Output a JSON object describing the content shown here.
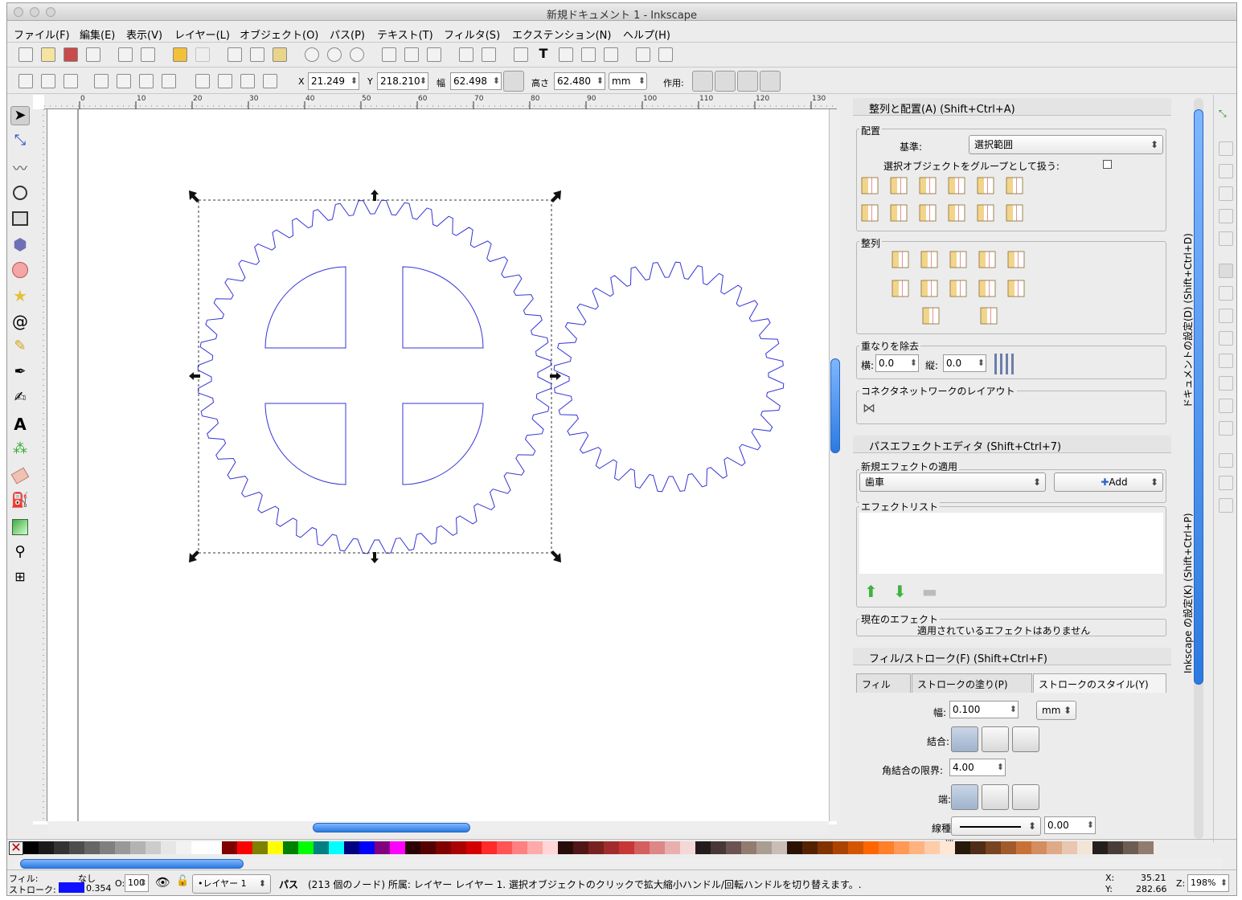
{
  "window": {
    "title": "新規ドキュメント 1 - Inkscape"
  },
  "menu": [
    "ファイル(F)",
    "編集(E)",
    "表示(V)",
    "レイヤー(L)",
    "オブジェクト(O)",
    "パス(P)",
    "テキスト(T)",
    "フィルタ(S)",
    "エクステンション(N)",
    "ヘルプ(H)"
  ],
  "controls": {
    "x_label": "X",
    "x_value": "21.249",
    "y_label": "Y",
    "y_value": "218.210",
    "w_label": "幅",
    "w_value": "62.498",
    "h_label": "高さ",
    "h_value": "62.480",
    "unit": "mm",
    "apply_label": "作用:"
  },
  "ruler": {
    "top": [
      "0",
      "10",
      "20",
      "30",
      "40",
      "50",
      "60",
      "70",
      "80",
      "90",
      "100",
      "110",
      "120",
      "130"
    ]
  },
  "align_panel": {
    "title": "整列と配置(A) (Shift+Ctrl+A)",
    "placement_label": "配置",
    "relative_label": "基準:",
    "relative_value": "選択範囲",
    "group_label": "選択オブジェクトをグループとして扱う:",
    "distribute_label": "整列",
    "overlap_label": "重なりを除去",
    "h_label": "横:",
    "h_value": "0.0",
    "v_label": "縦:",
    "v_value": "0.0",
    "connector_label": "コネクタネットワークのレイアウト"
  },
  "lpe_panel": {
    "title": "パスエフェクトエディタ (Shift+Ctrl+7)",
    "new_label": "新規エフェクトの適用",
    "effect_value": "歯車",
    "add_label": "Add",
    "list_label": "エフェクトリスト",
    "current_label": "現在のエフェクト",
    "current_value": "適用されているエフェクトはありません"
  },
  "fill_panel": {
    "title": "フィル/ストローク(F) (Shift+Ctrl+F)",
    "tab_fill": "フィル",
    "tab_stroke_paint": "ストロークの塗り(P)",
    "tab_stroke_style": "ストロークのスタイル(Y)",
    "width_label": "幅:",
    "width_value": "0.100",
    "width_unit": "mm",
    "join_label": "結合:",
    "miter_label": "角結合の限界:",
    "miter_value": "4.00",
    "cap_label": "端:",
    "dash_label": "線種:",
    "dash_offset": "0.00",
    "marker_label": "端"
  },
  "vertical_tabs": {
    "docprops": "ドキュメントの設定(D) (Shift+Ctrl+D)",
    "prefs": "Inkscape の設定(K) (Shift+Ctrl+P)"
  },
  "status": {
    "fill_label": "フィル:",
    "fill_value": "なし",
    "stroke_label": "ストローク:",
    "stroke_value": "0.354",
    "opacity_label": "O:",
    "opacity_value": "100",
    "layer": "•レイヤー 1",
    "message_bold": "パス",
    "message": "(213 個のノード) 所属: レイヤー レイヤー 1. 選択オブジェクトのクリックで拡大縮小ハンドル/回転ハンドルを切り替えます。.",
    "cursor_x_label": "X:",
    "cursor_x": "35.21",
    "cursor_y_label": "Y:",
    "cursor_y": "282.66",
    "zoom_label": "Z:",
    "zoom": "198%"
  },
  "colors": {
    "stroke": "#1010ff",
    "gear": "#3434d8",
    "accent": "#2b7ae0"
  }
}
